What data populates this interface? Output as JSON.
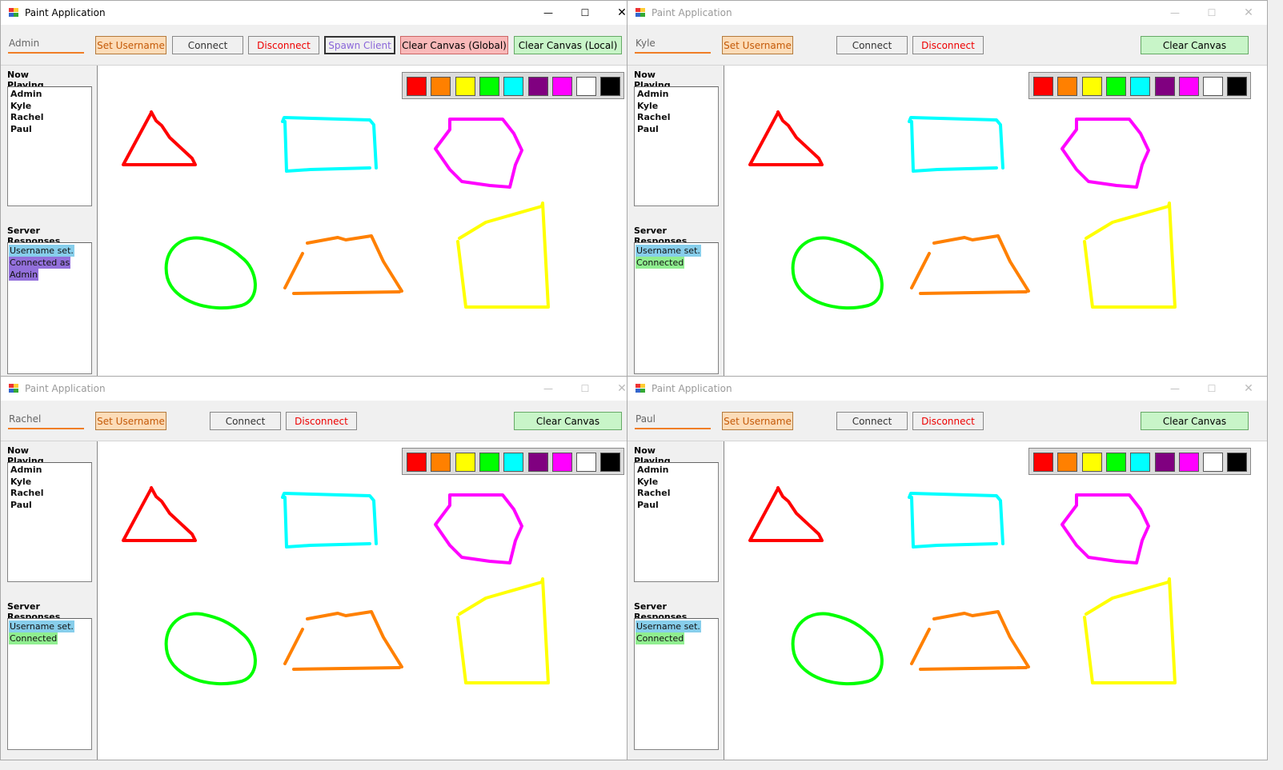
{
  "window": {
    "title": "Paint Application",
    "min_glyph": "—",
    "max_glyph": "☐",
    "close_glyph": "✕",
    "icon": "paint-app-icon"
  },
  "labels": {
    "now_playing": "Now Playing",
    "server_responses": "Server Responses",
    "set_username": "Set Username",
    "connect": "Connect",
    "disconnect": "Disconnect",
    "spawn_client": "Spawn Client",
    "clear_global": "Clear Canvas (Global)",
    "clear_local": "Clear Canvas (Local)",
    "clear_canvas": "Clear Canvas"
  },
  "players": [
    "Admin",
    "Kyle",
    "Rachel",
    "Paul"
  ],
  "palette": [
    {
      "name": "red",
      "color": "#ff0000"
    },
    {
      "name": "orange",
      "color": "#ff8000"
    },
    {
      "name": "yellow",
      "color": "#ffff00"
    },
    {
      "name": "green",
      "color": "#00ff00"
    },
    {
      "name": "cyan",
      "color": "#00ffff"
    },
    {
      "name": "purple",
      "color": "#800080"
    },
    {
      "name": "magenta",
      "color": "#ff00ff"
    },
    {
      "name": "white",
      "color": "#ffffff"
    },
    {
      "name": "black",
      "color": "#000000"
    }
  ],
  "windows": [
    {
      "username": "Admin",
      "active": true,
      "responses": [
        {
          "text": "Username set.",
          "color": "#87ceeb"
        },
        {
          "text": "Connected as",
          "color": "#9370db"
        },
        {
          "text": "Admin",
          "color": "#9370db"
        }
      ]
    },
    {
      "username": "Kyle",
      "active": false,
      "responses": [
        {
          "text": "Username set.",
          "color": "#87ceeb"
        },
        {
          "text": "Connected",
          "color": "#90ee90"
        }
      ]
    },
    {
      "username": "Rachel",
      "active": false,
      "responses": [
        {
          "text": "Username set.",
          "color": "#87ceeb"
        },
        {
          "text": "Connected",
          "color": "#90ee90"
        }
      ]
    },
    {
      "username": "Paul",
      "active": false,
      "responses": [
        {
          "text": "Username set.",
          "color": "#87ceeb"
        },
        {
          "text": "Connected",
          "color": "#90ee90"
        }
      ]
    }
  ],
  "stroke_colors": {
    "red": "#ff0000",
    "cyan": "#00ffff",
    "magenta": "#ff00ff",
    "green": "#00ff00",
    "orange": "#ff8000",
    "yellow": "#ffff00"
  }
}
